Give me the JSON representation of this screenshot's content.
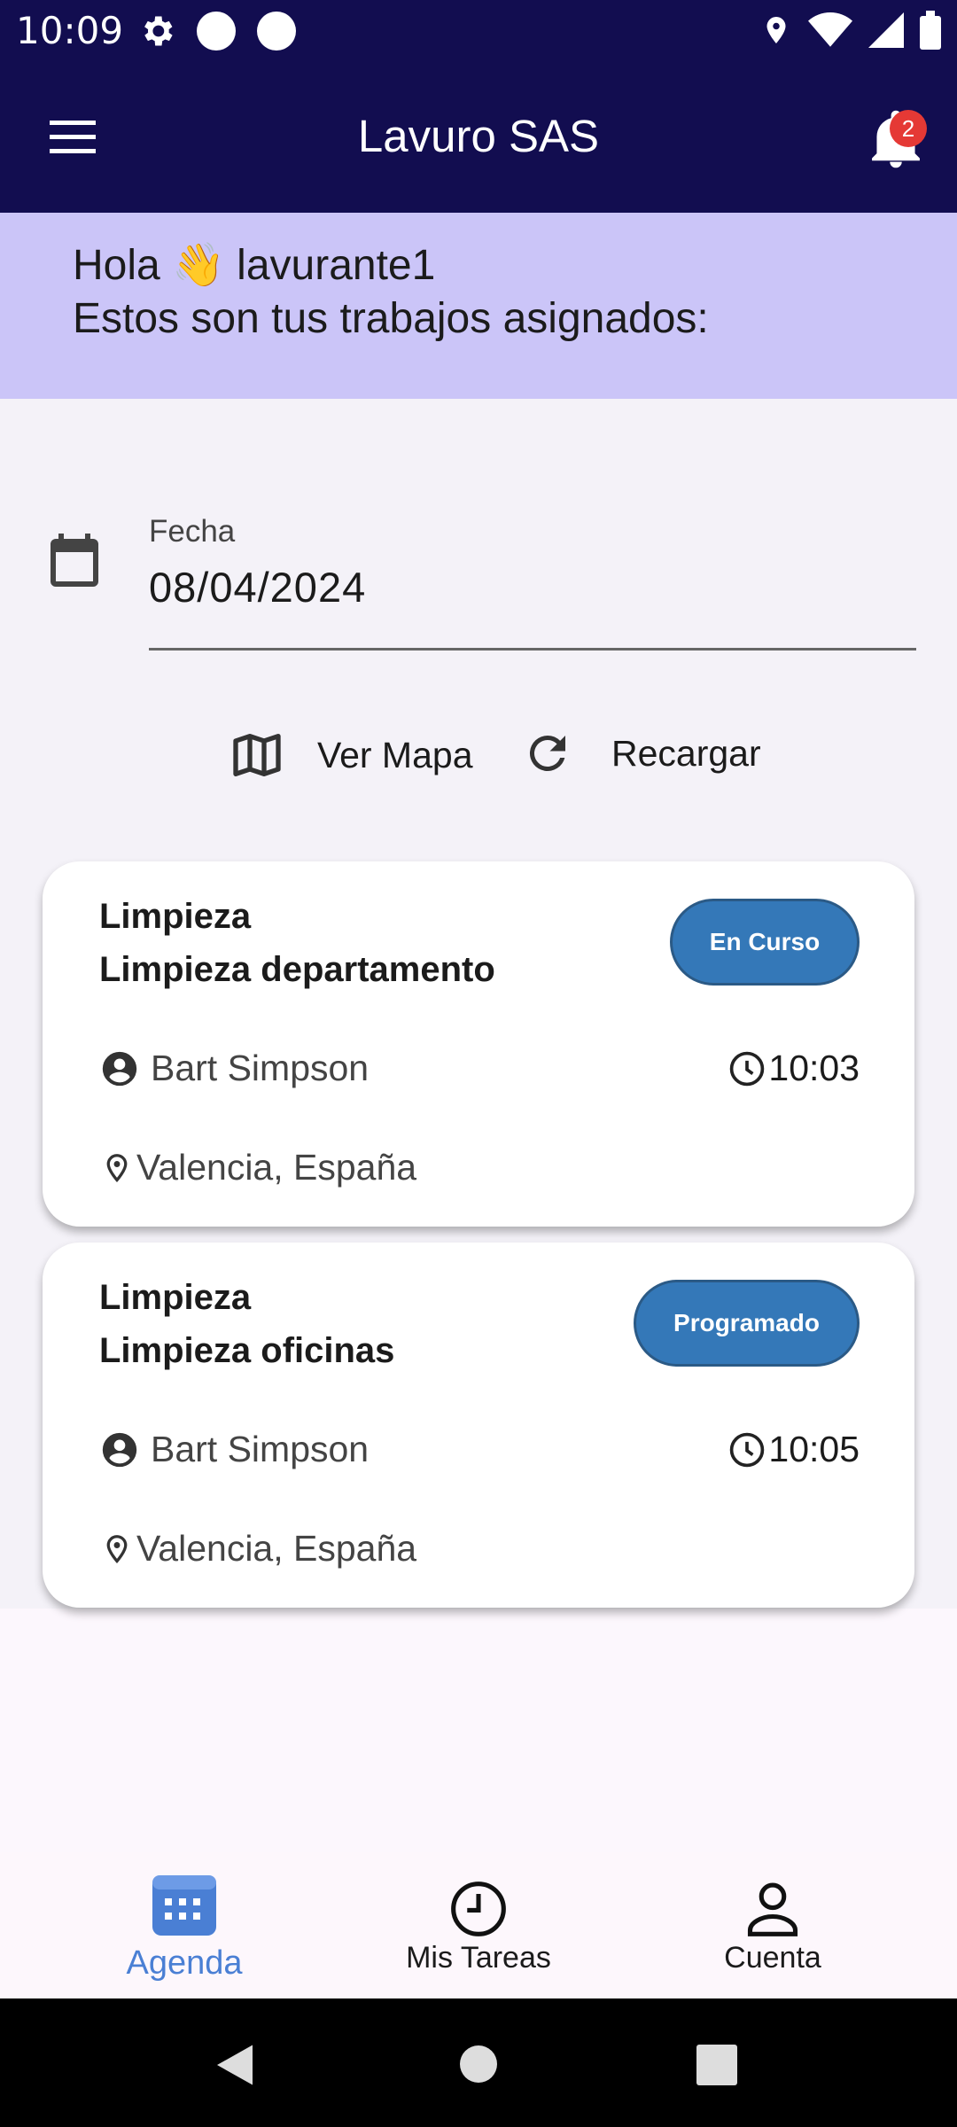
{
  "status_bar": {
    "time": "10:09"
  },
  "app_bar": {
    "title": "Lavuro SAS",
    "notification_count": "2"
  },
  "greeting": {
    "line1": "Hola 👋 lavurante1",
    "line2": "Estos son tus trabajos asignados:"
  },
  "date_field": {
    "label": "Fecha",
    "value": "08/04/2024"
  },
  "actions": {
    "map_label": "Ver Mapa",
    "reload_label": "Recargar"
  },
  "jobs": [
    {
      "category": "Limpieza",
      "title": "Limpieza departamento",
      "status": "En Curso",
      "person": "Bart Simpson",
      "time": "10:03",
      "location": "Valencia,  España"
    },
    {
      "category": "Limpieza",
      "title": "Limpieza oficinas",
      "status": "Programado",
      "person": "Bart Simpson",
      "time": "10:05",
      "location": "Valencia,  España"
    }
  ],
  "bottom_nav": {
    "items": [
      {
        "label": "Agenda",
        "active": true
      },
      {
        "label": "Mis Tareas",
        "active": false
      },
      {
        "label": "Cuenta",
        "active": false
      }
    ]
  },
  "colors": {
    "app_bar": "#120d50",
    "greeting_bg": "#cbc5f8",
    "status_button": "#3478b8",
    "active_nav": "#4a7fd4"
  }
}
